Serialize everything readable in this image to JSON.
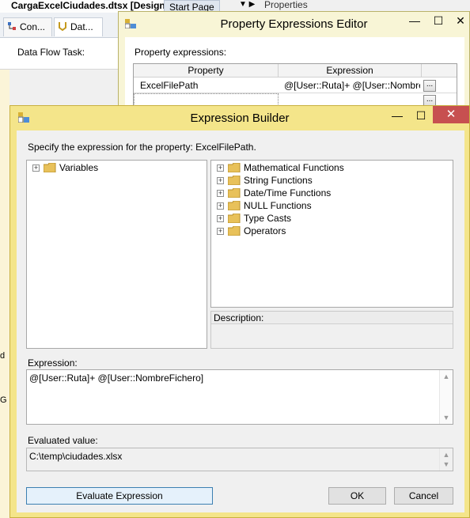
{
  "ide": {
    "document_tab": "CargaExcelCiudades.dtsx [Design]*",
    "start_tab": "Start Page",
    "properties_label": "Properties",
    "sub_tabs": [
      "Con...",
      "Dat..."
    ],
    "canvas_label": "Data Flow Task:",
    "edge_fragments": [
      "d",
      "G"
    ]
  },
  "property_expressions_editor": {
    "title": "Property Expressions Editor",
    "label": "Property expressions:",
    "columns": [
      "Property",
      "Expression"
    ],
    "rows": [
      {
        "property": "ExcelFilePath",
        "expression": "@[User::Ruta]+ @[User::Nombre..."
      }
    ],
    "ellipsis": "..."
  },
  "expression_builder": {
    "title": "Expression Builder",
    "prompt": "Specify the expression for the property: ExcelFilePath.",
    "variables_tree": [
      {
        "label": "Variables"
      }
    ],
    "functions_tree": [
      {
        "label": "Mathematical Functions"
      },
      {
        "label": "String Functions"
      },
      {
        "label": "Date/Time Functions"
      },
      {
        "label": "NULL Functions"
      },
      {
        "label": "Type Casts"
      },
      {
        "label": "Operators"
      }
    ],
    "description_label": "Description:",
    "expression_label": "Expression:",
    "expression_value": "@[User::Ruta]+ @[User::NombreFichero]",
    "evaluated_label": "Evaluated value:",
    "evaluated_value": "C:\\temp\\ciudades.xlsx",
    "evaluate_button": "Evaluate Expression",
    "ok_button": "OK",
    "cancel_button": "Cancel"
  },
  "window_controls": {
    "minimize": "—",
    "maximize": "☐",
    "close": "✕"
  },
  "colors": {
    "active_title": "#f4e58a",
    "inactive_title": "#f8f5d6",
    "close_red": "#c75050",
    "folder_yellow": "#e8c15a"
  }
}
